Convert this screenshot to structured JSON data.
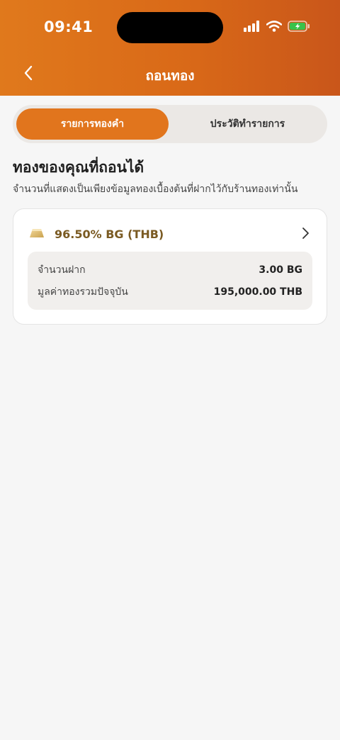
{
  "status_bar": {
    "time": "09:41"
  },
  "nav": {
    "title": "ถอนทอง"
  },
  "tabs": [
    {
      "label": "รายการทองคำ",
      "active": true
    },
    {
      "label": "ประวัติทำรายการ",
      "active": false
    }
  ],
  "section": {
    "title": "ทองของคุณที่ถอนได้",
    "subtitle": "จำนวนที่แสดงเป็นเพียงข้อมูลทองเบื้องต้นที่ฝากไว้กับร้านทองเท่านั้น"
  },
  "gold_item": {
    "title": "96.50% BG (THB)",
    "rows": [
      {
        "label": "จำนวนฝาก",
        "value": "3.00 BG"
      },
      {
        "label": "มูลค่าทองรวมปัจจุบัน",
        "value": "195,000.00 THB"
      }
    ]
  },
  "colors": {
    "header_start": "#e0791c",
    "header_end": "#c9561a",
    "accent": "#e1751d",
    "gold_text": "#7a5a22",
    "battery_fill": "#39c24a"
  },
  "icons": {
    "back": "chevron-left-icon",
    "signal": "signal-icon",
    "wifi": "wifi-icon",
    "battery": "battery-charging-icon",
    "gold_bar": "gold-bar-icon",
    "chevron": "chevron-right-icon"
  }
}
